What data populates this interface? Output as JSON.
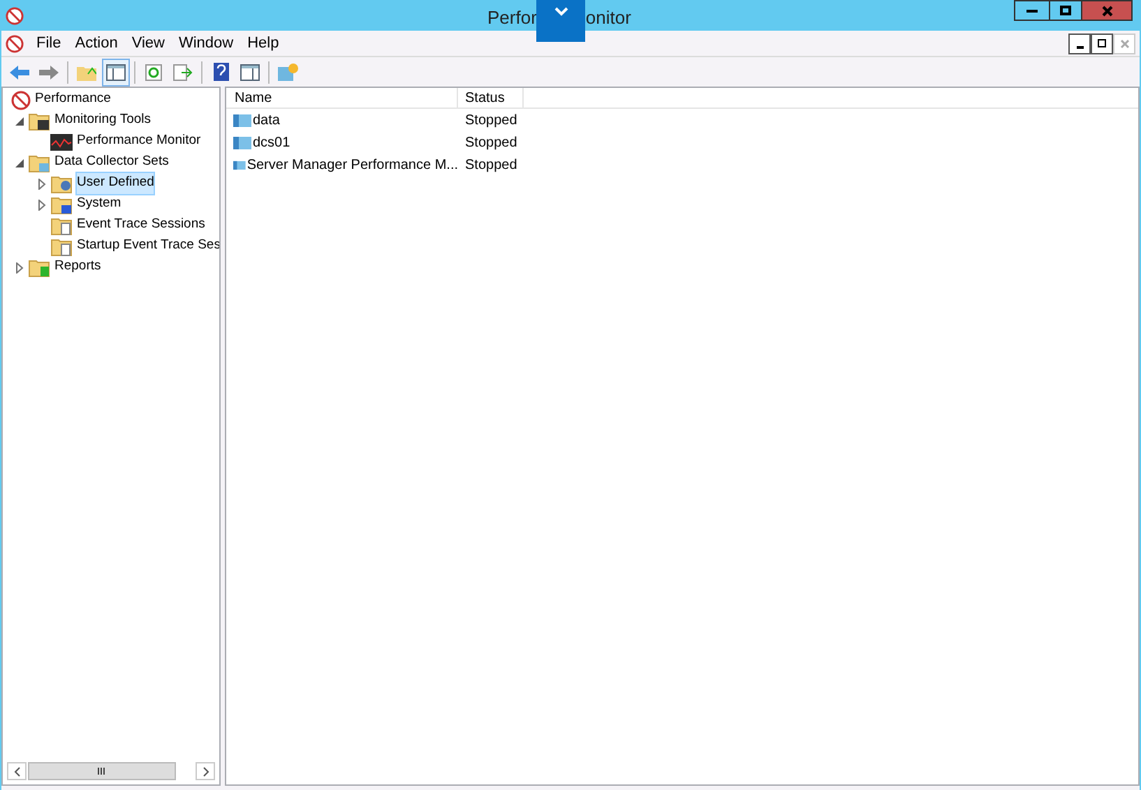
{
  "window": {
    "title_left": "Perfor",
    "title_right": "onitor"
  },
  "menu": [
    "File",
    "Action",
    "View",
    "Window",
    "Help"
  ],
  "tree": [
    {
      "label": "Performance",
      "kind": "app",
      "selected": false,
      "expandable": false,
      "children": [
        {
          "label": "Monitoring Tools",
          "kind": "folder-monitor",
          "selected": false,
          "expandable": true,
          "expanded": true,
          "children": [
            {
              "label": "Performance Monitor",
              "kind": "graph",
              "selected": false,
              "expandable": false
            }
          ]
        },
        {
          "label": "Data Collector Sets",
          "kind": "folder-sets",
          "selected": false,
          "expandable": true,
          "expanded": true,
          "children": [
            {
              "label": "User Defined",
              "kind": "folder-user",
              "selected": true,
              "expandable": true,
              "expanded": false
            },
            {
              "label": "System",
              "kind": "folder-system",
              "selected": false,
              "expandable": true,
              "expanded": false
            },
            {
              "label": "Event Trace Sessions",
              "kind": "folder-doc",
              "selected": false,
              "expandable": false
            },
            {
              "label": "Startup Event Trace Ses",
              "kind": "folder-doc",
              "selected": false,
              "expandable": false
            }
          ]
        },
        {
          "label": "Reports",
          "kind": "folder-report",
          "selected": false,
          "expandable": true,
          "expanded": false
        }
      ]
    }
  ],
  "table": {
    "columns": [
      "Name",
      "Status"
    ],
    "rows": [
      {
        "name": "data",
        "status": "Stopped"
      },
      {
        "name": "dcs01",
        "status": "Stopped"
      },
      {
        "name": "Server Manager Performance M...",
        "status": "Stopped"
      }
    ]
  }
}
